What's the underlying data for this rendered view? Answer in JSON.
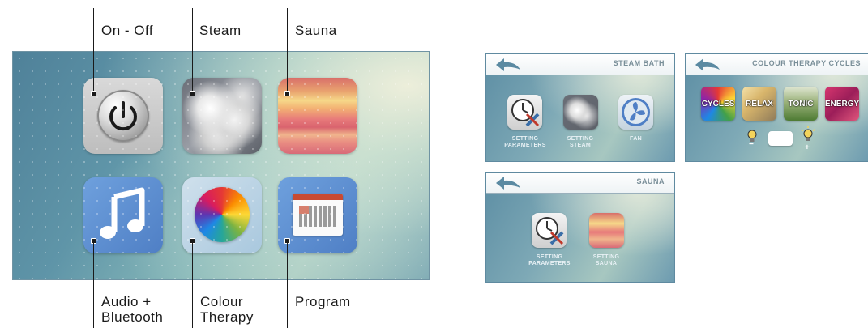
{
  "main": {
    "labels": {
      "on_off": "On - Off",
      "steam": "Steam",
      "sauna": "Sauna",
      "audio_line1": "Audio +",
      "audio_line2": "Bluetooth",
      "colour_line1": "Colour",
      "colour_line2": "Therapy",
      "program": "Program"
    },
    "icons": [
      "power-icon",
      "steam-icon",
      "sauna-icon",
      "music-note-icon",
      "colour-wheel-icon",
      "calendar-icon"
    ]
  },
  "steam_bath": {
    "title": "STEAM BATH",
    "items": [
      {
        "caption_line1": "SETTING",
        "caption_line2": "PARAMETERS",
        "icon": "clock-tools-icon"
      },
      {
        "caption_line1": "SETTING",
        "caption_line2": "STEAM",
        "icon": "steam-icon"
      },
      {
        "caption_line1": "FAN",
        "caption_line2": "",
        "icon": "fan-icon"
      }
    ]
  },
  "colour_therapy": {
    "title": "COLOUR THERAPY CYCLES",
    "tiles": [
      "CYCLES",
      "RELAX",
      "TONIC",
      "ENERGY"
    ],
    "minus": "−",
    "plus": "+",
    "icons": [
      "bulb-dim-icon",
      "bulb-bright-icon"
    ]
  },
  "sauna": {
    "title": "SAUNA",
    "items": [
      {
        "caption_line1": "SETTING",
        "caption_line2": "PARAMETERS",
        "icon": "clock-tools-icon"
      },
      {
        "caption_line1": "SETTING",
        "caption_line2": "SAUNA",
        "icon": "sauna-icon"
      }
    ]
  },
  "colors": {
    "accent_blue": "#4f7fc5",
    "screen_teal": "#5f95a8",
    "arrow": "#5b8aa2"
  }
}
